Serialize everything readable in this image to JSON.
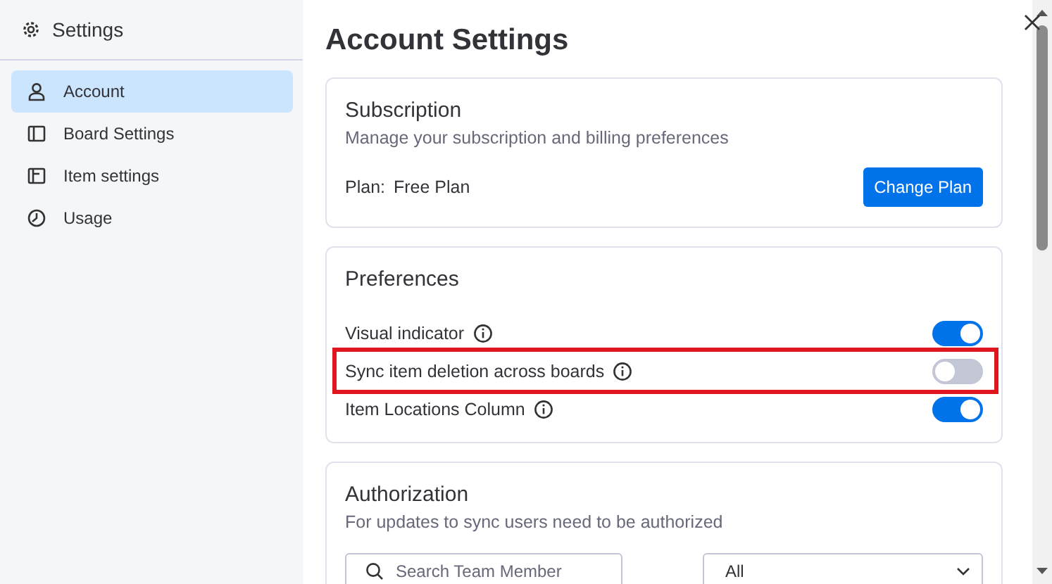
{
  "sidebar": {
    "title": "Settings",
    "items": [
      {
        "label": "Account",
        "kind": "person",
        "selected": true
      },
      {
        "label": "Board Settings",
        "kind": "board",
        "selected": false
      },
      {
        "label": "Item settings",
        "kind": "item",
        "selected": false
      },
      {
        "label": "Usage",
        "kind": "clock",
        "selected": false
      }
    ]
  },
  "page_title": "Account Settings",
  "subscription": {
    "title": "Subscription",
    "description": "Manage your subscription and billing preferences",
    "plan_label": "Plan:",
    "plan_value": "Free Plan",
    "button": "Change Plan"
  },
  "preferences": {
    "title": "Preferences",
    "items": [
      {
        "label": "Visual indicator",
        "on": true,
        "highlighted": false
      },
      {
        "label": "Sync item deletion across boards",
        "on": false,
        "highlighted": true
      },
      {
        "label": "Item Locations Column",
        "on": true,
        "highlighted": false
      }
    ]
  },
  "authorization": {
    "title": "Authorization",
    "description": "For updates to sync users need to be authorized",
    "search": {
      "placeholder": "Search Team Member"
    },
    "filter": {
      "value": "All"
    }
  }
}
